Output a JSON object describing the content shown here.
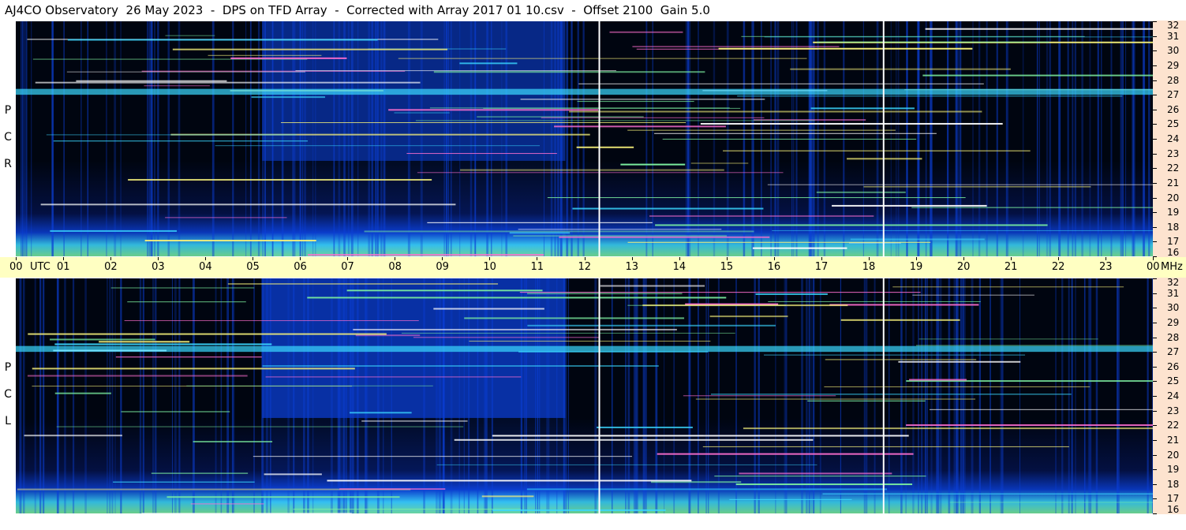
{
  "title": "AJ4CO Observatory  26 May 2023  -  DPS on TFD Array  -  Corrected with Array 2017 01 10.csv  -  Offset 2100  Gain 5.0",
  "panels": [
    {
      "polarization_letters": [
        "R",
        "C",
        "P"
      ]
    },
    {
      "polarization_letters": [
        "L",
        "C",
        "P"
      ]
    }
  ],
  "colors": {
    "background": "#ffffff",
    "time_axis_bg": "#ffffc2",
    "freq_scale_bg": "#fde3cf",
    "spectrogram_dark": "#000510",
    "spectrogram_blue": "#0b3fd6",
    "spectrogram_cyan": "#3bd8ff",
    "spectrogram_green": "#7cf0a0",
    "spectrogram_yellow": "#f5f07a"
  },
  "chart_data": {
    "type": "heatmap",
    "title": "AJ4CO Observatory  26 May 2023  -  DPS on TFD Array  -  Corrected with Array 2017 01 10.csv  -  Offset 2100  Gain 5.0",
    "x_axis": {
      "range": [
        0,
        24
      ],
      "tick_labels": [
        "00",
        "UTC",
        "01",
        "02",
        "03",
        "04",
        "05",
        "06",
        "07",
        "08",
        "09",
        "10",
        "11",
        "12",
        "13",
        "14",
        "15",
        "16",
        "17",
        "18",
        "19",
        "20",
        "21",
        "22",
        "23",
        "00",
        "MHz"
      ]
    },
    "y_axis": {
      "range": [
        16,
        32
      ],
      "unit": "MHz",
      "tick_labels": [
        "32",
        "31",
        "30",
        "29",
        "28",
        "27",
        "26",
        "25",
        "24",
        "23",
        "22",
        "21",
        "20",
        "19",
        "18",
        "17",
        "16"
      ]
    },
    "series": [
      {
        "name": "RCP"
      },
      {
        "name": "LCP"
      }
    ],
    "vertical_markers_utc": [
      12.3,
      18.3
    ]
  }
}
